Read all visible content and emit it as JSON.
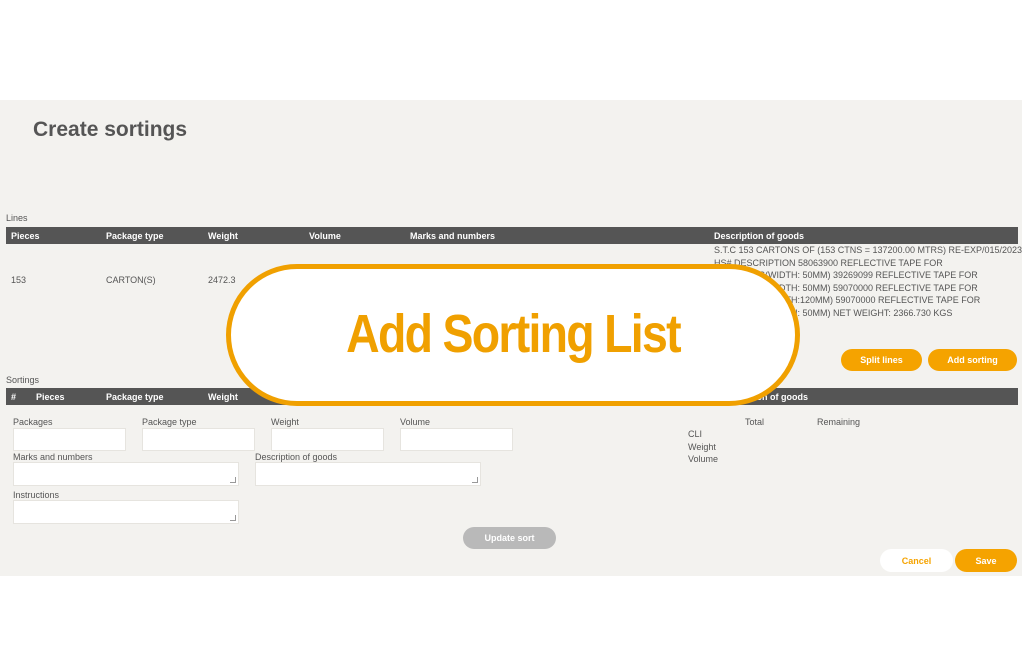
{
  "page": {
    "title": "Create sortings"
  },
  "lines": {
    "label": "Lines",
    "headers": {
      "pieces": "Pieces",
      "package_type": "Package type",
      "weight": "Weight",
      "volume": "Volume",
      "marks": "Marks and numbers",
      "description": "Description of goods"
    },
    "row": {
      "pieces": "153",
      "package_type": "CARTON(S)",
      "weight": "2472.3",
      "description_lines": [
        "S.T.C 153 CARTONS OF (153 CTNS = 137200.00 MTRS) RE-EXP/015/2023",
        "HS# DESCRIPTION 58063900 REFLECTIVE TAPE FOR",
        "GARMENTS(WIDTH: 50MM) 39269099 REFLECTIVE TAPE FOR",
        "GARMENTS(WIDTH: 50MM) 59070000 REFLECTIVE TAPE FOR",
        "GARMENTS(WIDTH:120MM) 59070000 REFLECTIVE TAPE FOR",
        "GARMENTS(WIDTH: 50MM) NET WEIGHT: 2366.730 KGS"
      ]
    },
    "buttons": {
      "split": "Split lines",
      "add": "Add sorting"
    }
  },
  "sortings": {
    "label": "Sortings",
    "headers": {
      "number": "#",
      "pieces": "Pieces",
      "package_type": "Package type",
      "weight": "Weight",
      "description": "Description of goods"
    }
  },
  "form": {
    "packages": "Packages",
    "package_type": "Package type",
    "weight": "Weight",
    "volume": "Volume",
    "marks": "Marks and numbers",
    "description": "Description of goods",
    "instructions": "Instructions",
    "update": "Update sort"
  },
  "summary": {
    "total": "Total",
    "remaining": "Remaining",
    "rows": [
      "CLI",
      "Weight",
      "Volume"
    ]
  },
  "footer": {
    "cancel": "Cancel",
    "save": "Save"
  },
  "banner": {
    "text": "Add Sorting List",
    "color": "#f0a000"
  },
  "colors": {
    "accent": "#f5a300",
    "header_bg": "#555555",
    "panel_bg": "#f3f2ef"
  }
}
